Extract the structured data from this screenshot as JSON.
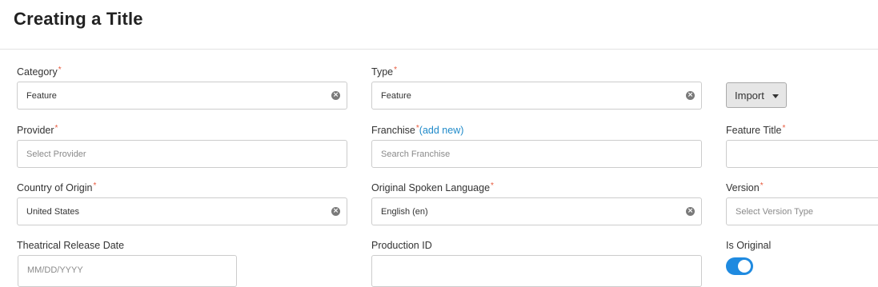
{
  "page": {
    "title": "Creating a Title"
  },
  "form": {
    "category": {
      "label": "Category",
      "required": "*",
      "value": "Feature"
    },
    "type": {
      "label": "Type",
      "required": "*",
      "value": "Feature"
    },
    "import_button": {
      "label": "Import"
    },
    "provider": {
      "label": "Provider",
      "required": "*",
      "placeholder": "Select Provider"
    },
    "franchise": {
      "label": "Franchise",
      "required": "*",
      "add_link": "add new",
      "placeholder": "Search Franchise"
    },
    "feature_title": {
      "label": "Feature Title",
      "required": "*",
      "value": ""
    },
    "country": {
      "label": "Country of Origin",
      "required": "*",
      "value": "United States"
    },
    "language": {
      "label": "Original Spoken Language",
      "required": "*",
      "value": "English (en)"
    },
    "version": {
      "label": "Version",
      "required": "*",
      "placeholder": "Select Version Type"
    },
    "release_date": {
      "label": "Theatrical Release Date",
      "placeholder": "MM/DD/YYYY"
    },
    "production_id": {
      "label": "Production ID",
      "value": ""
    },
    "is_original": {
      "label": "Is Original",
      "on": true
    }
  },
  "icons": {
    "clear": "clear-x-icon",
    "dropdown": "caret-down-icon"
  },
  "colors": {
    "required": "#e8593c",
    "link": "#1f8ac9",
    "toggle_on": "#1f8ae0"
  }
}
